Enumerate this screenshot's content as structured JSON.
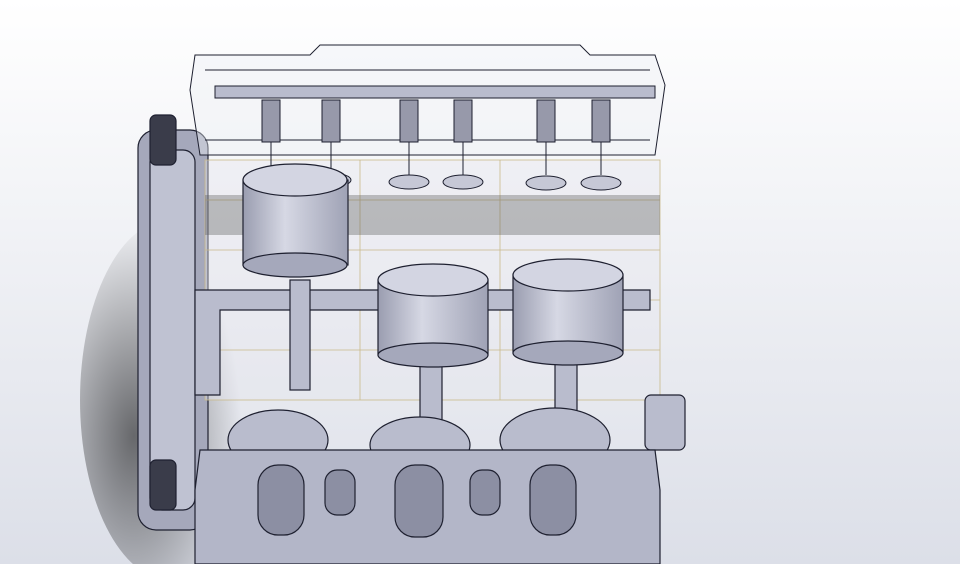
{
  "scene": {
    "subject": "engine-cad-model",
    "colors": {
      "background_top": "#ffffff",
      "background_bottom": "#dde0e8",
      "part_fill": "#b9bccd",
      "part_light": "#d3d5e2",
      "part_dark": "#7b7f93",
      "outline": "#1e2030",
      "wire": "#c9b98a"
    }
  }
}
